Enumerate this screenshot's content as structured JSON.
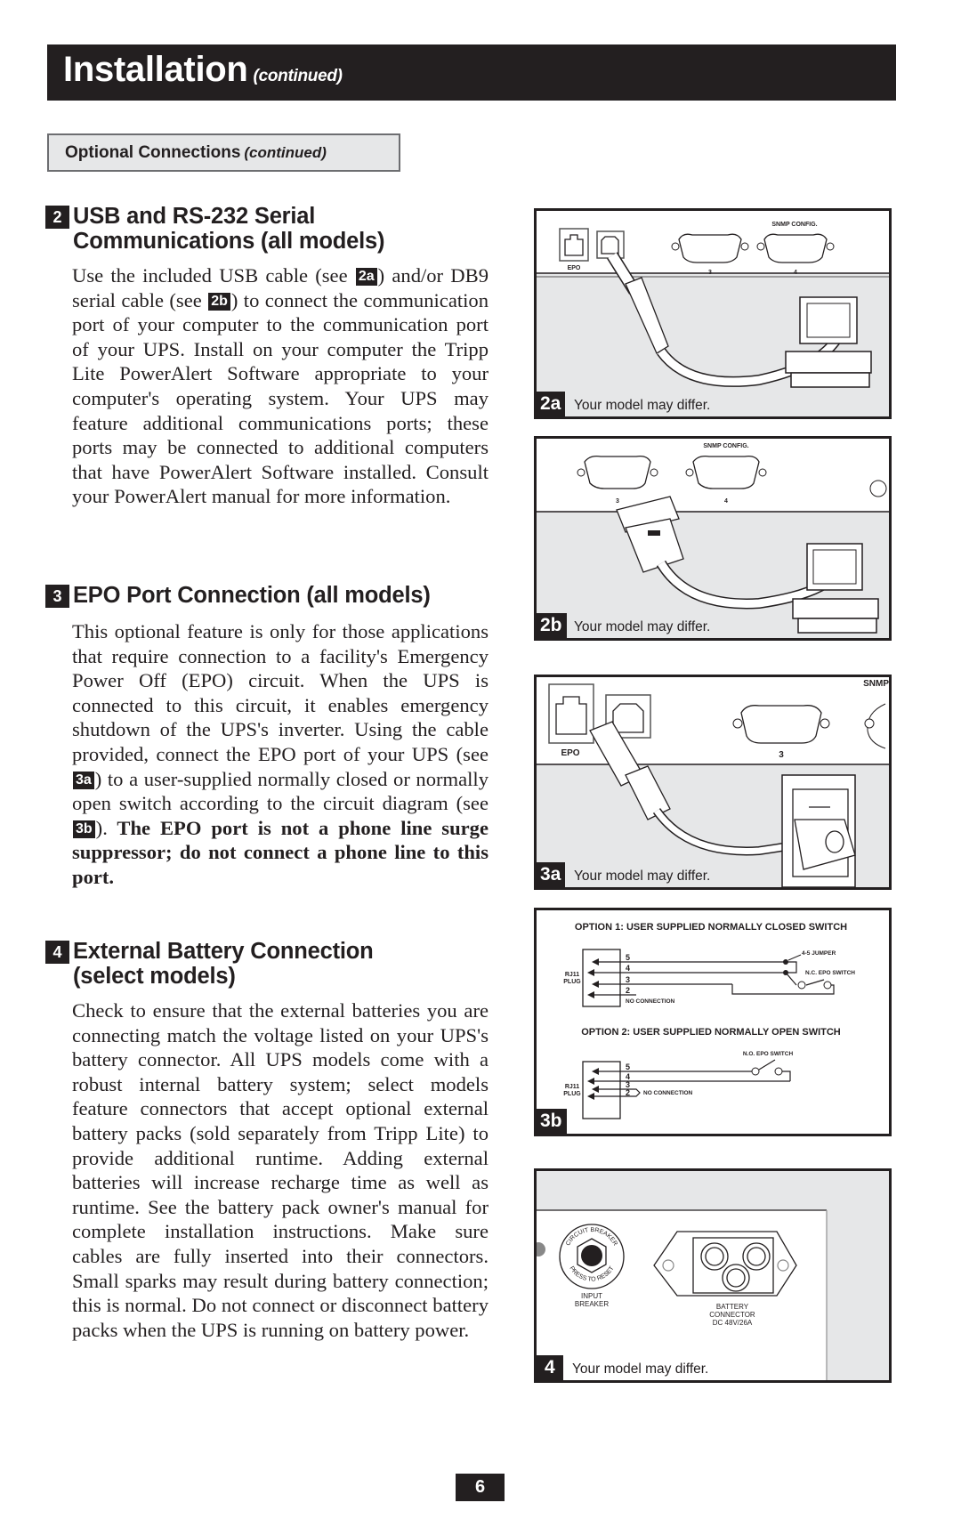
{
  "header": {
    "title": "Installation",
    "title_suffix": "(continued)"
  },
  "subheader": {
    "title": "Optional Connections",
    "title_suffix": "(continued)"
  },
  "sections": [
    {
      "number": "2",
      "heading_line1": "USB and RS-232 Serial",
      "heading_line2": "Communications (all models)",
      "body_part1": "Use the included USB cable (see ",
      "ref1": "2a",
      "body_part2": ") and/or DB9 serial cable (see ",
      "ref2": "2b",
      "body_part3": ") to connect the communication port of your computer to the communication port of your UPS. Install on your computer the Tripp Lite PowerAlert Software appropriate to your computer's operating system. Your UPS may feature additional communications ports; these ports may be connected to additional computers that have PowerAlert Software installed. Consult your PowerAlert manual for more information."
    },
    {
      "number": "3",
      "heading_line1": "EPO Port Connection (all models)",
      "body_part1": "This optional feature is only for those applications that require connection to a facility's Emergency Power Off (EPO) circuit. When the UPS is connected to this circuit, it enables emergency shutdown of the UPS's inverter. Using the cable provided, connect the EPO port of your UPS (see ",
      "ref1": "3a",
      "body_part2": ") to a user-supplied normally closed or normally open switch according to the circuit diagram (see ",
      "ref2": "3b",
      "body_part3": ").",
      "body_bold": " The EPO port is not a phone line surge suppressor; do not connect a phone line to this port."
    },
    {
      "number": "4",
      "heading_line1": "External Battery Connection",
      "heading_line2": "(select models)",
      "body": "Check to ensure that the external batteries you are connecting match the voltage listed on your UPS's battery connector. All UPS models come with a robust internal battery system; select models feature connectors that accept optional external battery packs (sold separately from Tripp Lite) to provide additional runtime. Adding external batteries will increase recharge time as well as runtime. See the battery pack owner's manual for complete installation instructions. Make sure cables are fully inserted into their connectors. Small sparks may result during battery connection; this is normal. Do not connect or disconnect battery packs when the UPS is running on battery power."
    }
  ],
  "figures": {
    "fig2a": {
      "label": "2a",
      "caption": "Your model may differ.",
      "port_labels": {
        "epo": "EPO",
        "port3": "3",
        "port4": "4",
        "snmp": "SNMP CONFIG."
      }
    },
    "fig2b": {
      "label": "2b",
      "caption": "Your model may differ.",
      "port_labels": {
        "port3": "3",
        "port4": "4",
        "snmp": "SNMP CONFIG."
      }
    },
    "fig3a": {
      "label": "3a",
      "caption": "Your model may differ.",
      "port_labels": {
        "epo": "EPO",
        "port3": "3",
        "snmp": "SNMP"
      }
    },
    "fig3b": {
      "label": "3b",
      "option1_title": "OPTION 1: USER SUPPLIED NORMALLY CLOSED SWITCH",
      "option2_title": "OPTION 2: USER SUPPLIED NORMALLY OPEN SWITCH",
      "plug_label_1": "RJ11",
      "plug_label_2": "PLUG",
      "pins": [
        "5",
        "4",
        "3",
        "2"
      ],
      "jumper": "4-5 JUMPER",
      "nc_switch": "N.C. EPO SWITCH",
      "no_switch": "N.O. EPO SWITCH",
      "no_connection": "NO CONNECTION"
    },
    "fig4": {
      "label": "4",
      "caption": "Your model may differ.",
      "breaker_ring_top": "CIRCUIT BREAKER",
      "breaker_ring_bottom": "PRESS TO RESET",
      "breaker_label_1": "INPUT",
      "breaker_label_2": "BREAKER",
      "connector_label_1": "BATTERY",
      "connector_label_2": "CONNECTOR",
      "connector_rating": "DC 48V/26A"
    }
  },
  "page_number": "6"
}
